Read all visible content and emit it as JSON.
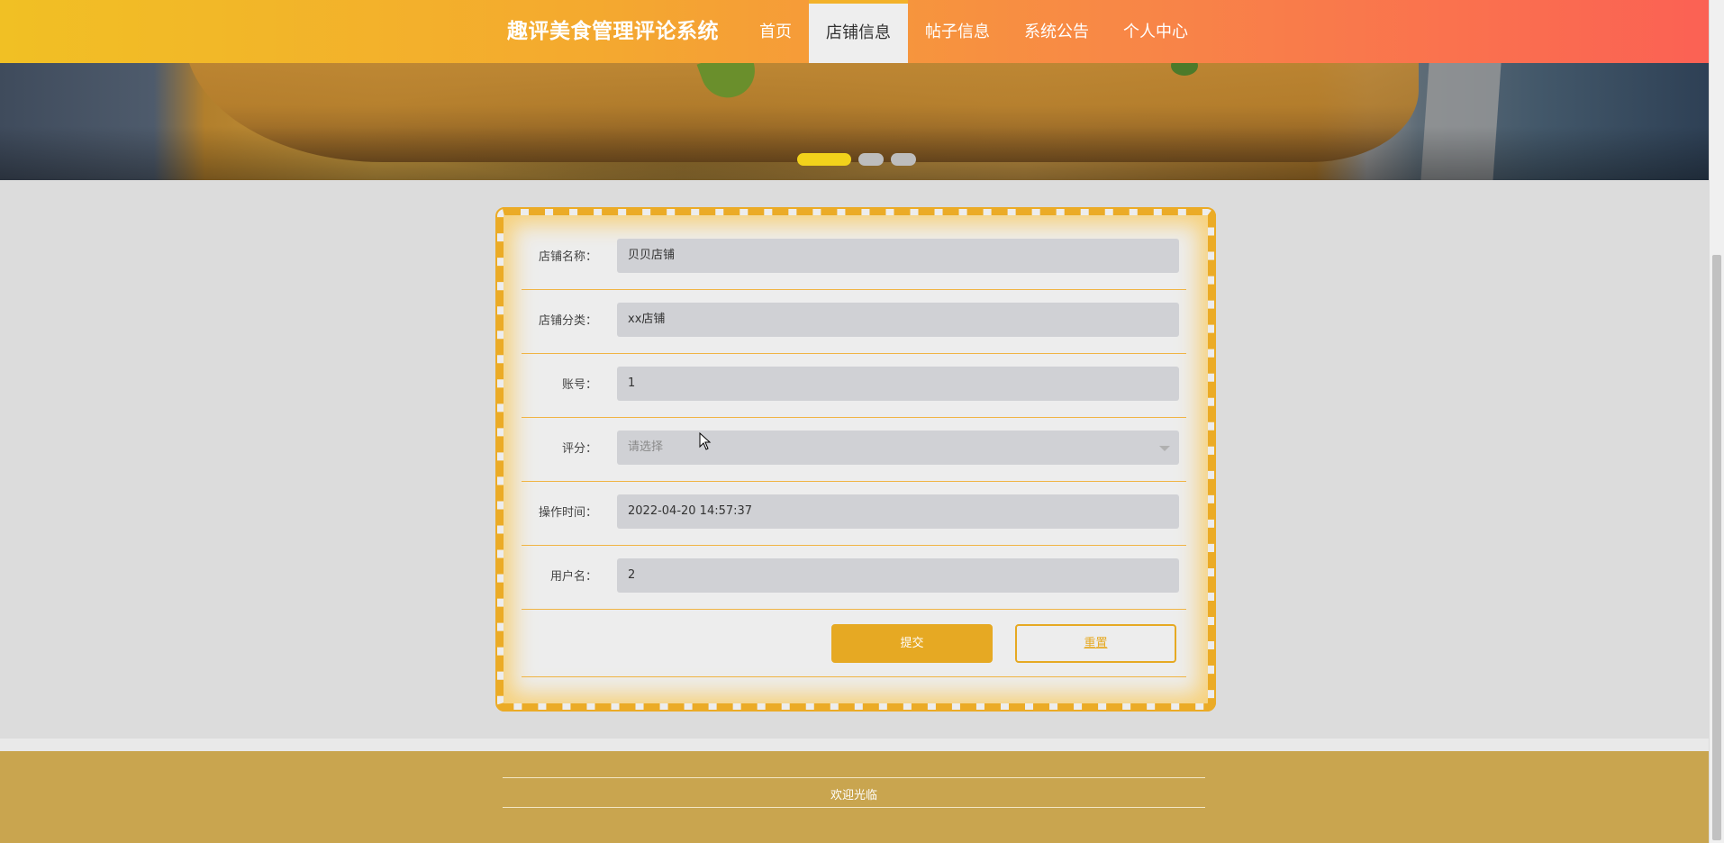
{
  "header": {
    "brand": "趣评美食管理评论系统",
    "nav": [
      {
        "label": "首页"
      },
      {
        "label": "店铺信息"
      },
      {
        "label": "帖子信息"
      },
      {
        "label": "系统公告"
      },
      {
        "label": "个人中心"
      }
    ],
    "active_index": 1
  },
  "carousel": {
    "slides": 3,
    "active_slide": 1
  },
  "form": {
    "fields": [
      {
        "label": "店铺名称：",
        "value": "贝贝店铺"
      },
      {
        "label": "店铺分类：",
        "value": "xx店铺"
      },
      {
        "label": "账号：",
        "value": "1"
      },
      {
        "label": "评分：",
        "placeholder": "请选择"
      },
      {
        "label": "操作时间：",
        "value": "2022-04-20 14:57:37"
      },
      {
        "label": "用户名：",
        "value": "2"
      }
    ],
    "submit_label": "提交",
    "reset_label": "重置"
  },
  "footer": {
    "text": "欢迎光临"
  },
  "colors": {
    "accent": "#e6a923",
    "header_start": "#f1c024",
    "header_end": "#fb6154",
    "footer_bg": "#c9a54f",
    "carousel_active": "#f2d21b"
  }
}
